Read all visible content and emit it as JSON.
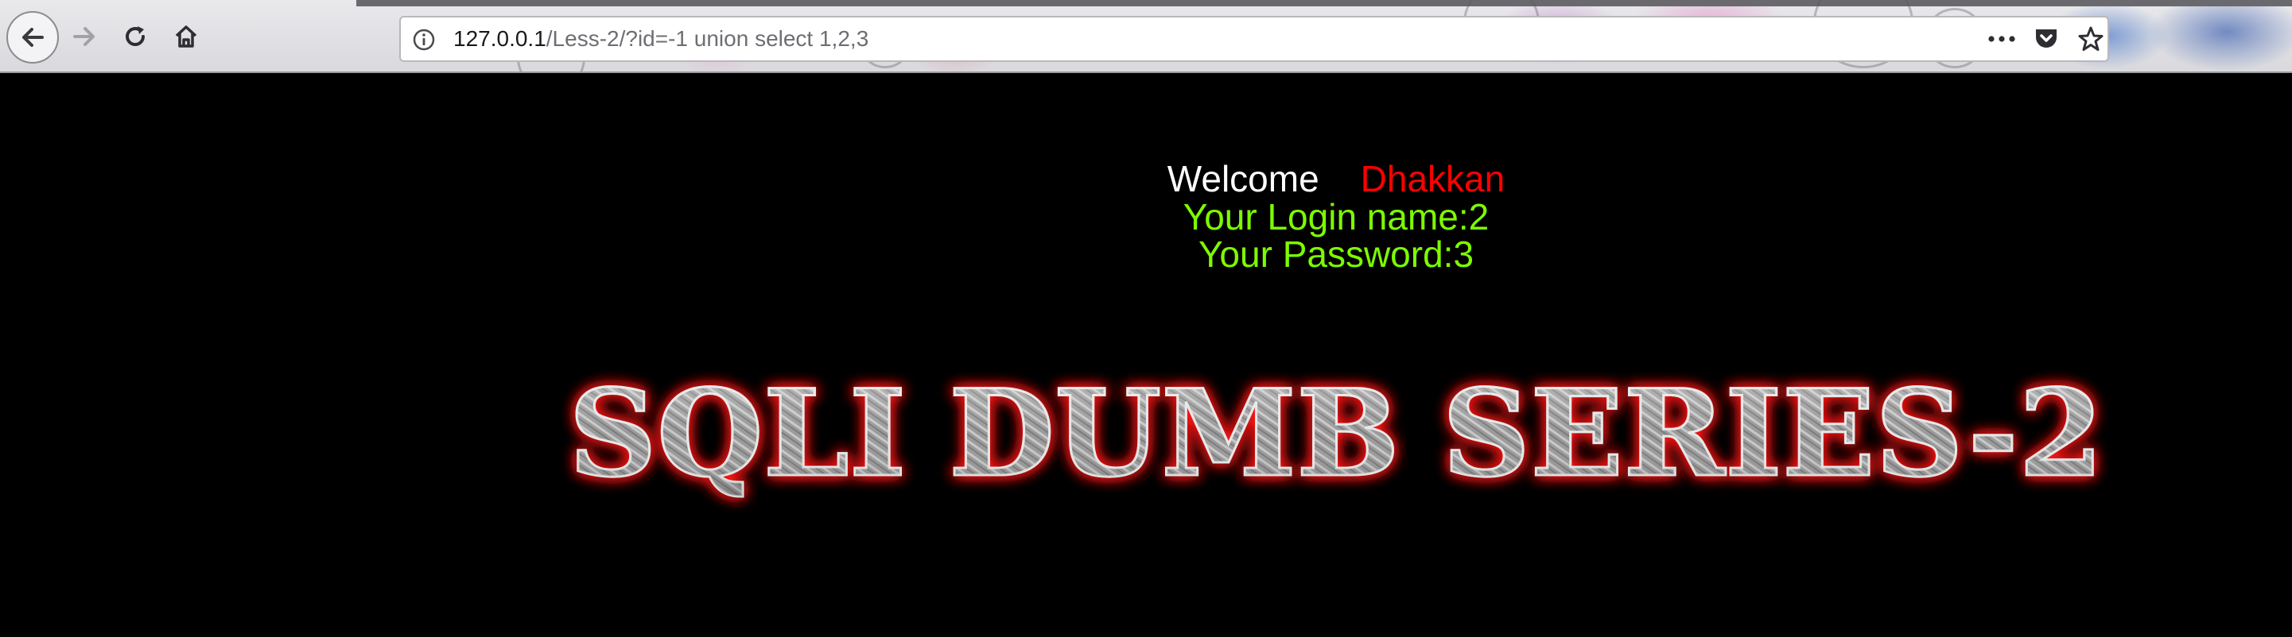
{
  "browser": {
    "url": {
      "host": "127.0.0.1",
      "path": "/Less-2/?id=-1 union select 1,2,3"
    },
    "icons": {
      "back": "back-arrow-icon",
      "forward": "forward-arrow-icon",
      "reload": "reload-icon",
      "home": "home-icon",
      "site_info": "info-icon",
      "page_actions": "more-horizontal-icon",
      "pocket": "pocket-icon",
      "bookmark": "star-icon"
    }
  },
  "page": {
    "welcome": {
      "label": "Welcome",
      "name": "Dhakkan"
    },
    "login_name": "Your Login name:2",
    "password": "Your Password:3",
    "banner_title": "SQLI DUMB SERIES-2",
    "colors": {
      "background": "#000000",
      "welcome": "#ffffff",
      "name": "#ff0000",
      "result": "#7cfc00",
      "banner_glow": "#ff1a1a"
    }
  }
}
